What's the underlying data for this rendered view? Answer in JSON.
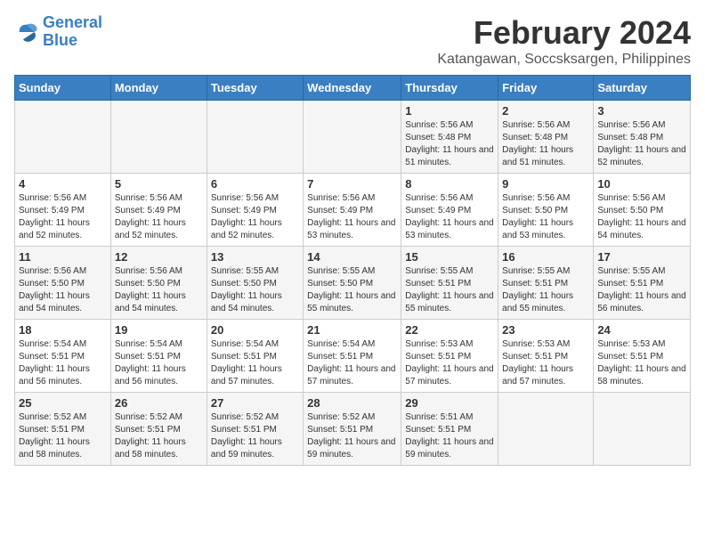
{
  "logo": {
    "line1": "General",
    "line2": "Blue"
  },
  "title": "February 2024",
  "subtitle": "Katangawan, Soccsksargen, Philippines",
  "headers": [
    "Sunday",
    "Monday",
    "Tuesday",
    "Wednesday",
    "Thursday",
    "Friday",
    "Saturday"
  ],
  "weeks": [
    [
      {
        "day": "",
        "info": ""
      },
      {
        "day": "",
        "info": ""
      },
      {
        "day": "",
        "info": ""
      },
      {
        "day": "",
        "info": ""
      },
      {
        "day": "1",
        "info": "Sunrise: 5:56 AM\nSunset: 5:48 PM\nDaylight: 11 hours and 51 minutes."
      },
      {
        "day": "2",
        "info": "Sunrise: 5:56 AM\nSunset: 5:48 PM\nDaylight: 11 hours and 51 minutes."
      },
      {
        "day": "3",
        "info": "Sunrise: 5:56 AM\nSunset: 5:48 PM\nDaylight: 11 hours and 52 minutes."
      }
    ],
    [
      {
        "day": "4",
        "info": "Sunrise: 5:56 AM\nSunset: 5:49 PM\nDaylight: 11 hours and 52 minutes."
      },
      {
        "day": "5",
        "info": "Sunrise: 5:56 AM\nSunset: 5:49 PM\nDaylight: 11 hours and 52 minutes."
      },
      {
        "day": "6",
        "info": "Sunrise: 5:56 AM\nSunset: 5:49 PM\nDaylight: 11 hours and 52 minutes."
      },
      {
        "day": "7",
        "info": "Sunrise: 5:56 AM\nSunset: 5:49 PM\nDaylight: 11 hours and 53 minutes."
      },
      {
        "day": "8",
        "info": "Sunrise: 5:56 AM\nSunset: 5:49 PM\nDaylight: 11 hours and 53 minutes."
      },
      {
        "day": "9",
        "info": "Sunrise: 5:56 AM\nSunset: 5:50 PM\nDaylight: 11 hours and 53 minutes."
      },
      {
        "day": "10",
        "info": "Sunrise: 5:56 AM\nSunset: 5:50 PM\nDaylight: 11 hours and 54 minutes."
      }
    ],
    [
      {
        "day": "11",
        "info": "Sunrise: 5:56 AM\nSunset: 5:50 PM\nDaylight: 11 hours and 54 minutes."
      },
      {
        "day": "12",
        "info": "Sunrise: 5:56 AM\nSunset: 5:50 PM\nDaylight: 11 hours and 54 minutes."
      },
      {
        "day": "13",
        "info": "Sunrise: 5:55 AM\nSunset: 5:50 PM\nDaylight: 11 hours and 54 minutes."
      },
      {
        "day": "14",
        "info": "Sunrise: 5:55 AM\nSunset: 5:50 PM\nDaylight: 11 hours and 55 minutes."
      },
      {
        "day": "15",
        "info": "Sunrise: 5:55 AM\nSunset: 5:51 PM\nDaylight: 11 hours and 55 minutes."
      },
      {
        "day": "16",
        "info": "Sunrise: 5:55 AM\nSunset: 5:51 PM\nDaylight: 11 hours and 55 minutes."
      },
      {
        "day": "17",
        "info": "Sunrise: 5:55 AM\nSunset: 5:51 PM\nDaylight: 11 hours and 56 minutes."
      }
    ],
    [
      {
        "day": "18",
        "info": "Sunrise: 5:54 AM\nSunset: 5:51 PM\nDaylight: 11 hours and 56 minutes."
      },
      {
        "day": "19",
        "info": "Sunrise: 5:54 AM\nSunset: 5:51 PM\nDaylight: 11 hours and 56 minutes."
      },
      {
        "day": "20",
        "info": "Sunrise: 5:54 AM\nSunset: 5:51 PM\nDaylight: 11 hours and 57 minutes."
      },
      {
        "day": "21",
        "info": "Sunrise: 5:54 AM\nSunset: 5:51 PM\nDaylight: 11 hours and 57 minutes."
      },
      {
        "day": "22",
        "info": "Sunrise: 5:53 AM\nSunset: 5:51 PM\nDaylight: 11 hours and 57 minutes."
      },
      {
        "day": "23",
        "info": "Sunrise: 5:53 AM\nSunset: 5:51 PM\nDaylight: 11 hours and 57 minutes."
      },
      {
        "day": "24",
        "info": "Sunrise: 5:53 AM\nSunset: 5:51 PM\nDaylight: 11 hours and 58 minutes."
      }
    ],
    [
      {
        "day": "25",
        "info": "Sunrise: 5:52 AM\nSunset: 5:51 PM\nDaylight: 11 hours and 58 minutes."
      },
      {
        "day": "26",
        "info": "Sunrise: 5:52 AM\nSunset: 5:51 PM\nDaylight: 11 hours and 58 minutes."
      },
      {
        "day": "27",
        "info": "Sunrise: 5:52 AM\nSunset: 5:51 PM\nDaylight: 11 hours and 59 minutes."
      },
      {
        "day": "28",
        "info": "Sunrise: 5:52 AM\nSunset: 5:51 PM\nDaylight: 11 hours and 59 minutes."
      },
      {
        "day": "29",
        "info": "Sunrise: 5:51 AM\nSunset: 5:51 PM\nDaylight: 11 hours and 59 minutes."
      },
      {
        "day": "",
        "info": ""
      },
      {
        "day": "",
        "info": ""
      }
    ]
  ]
}
